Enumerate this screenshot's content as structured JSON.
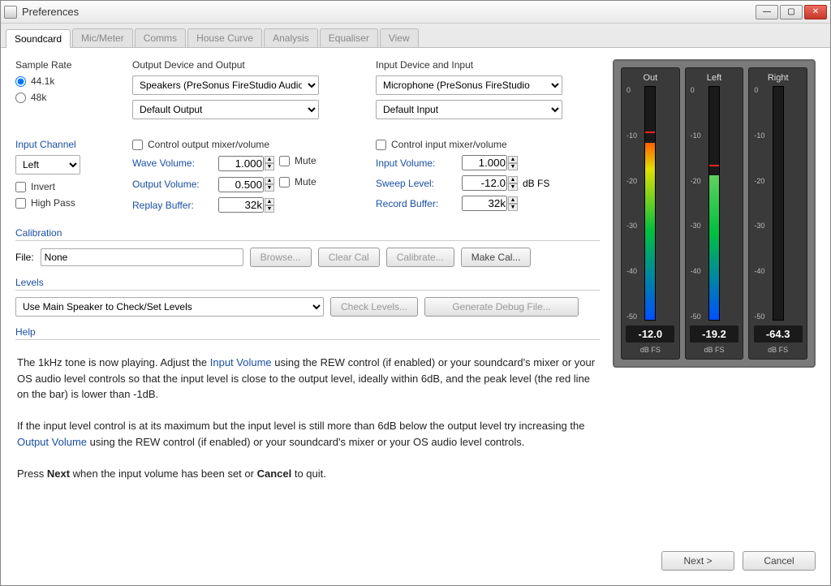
{
  "window": {
    "title": "Preferences"
  },
  "tabs": [
    "Soundcard",
    "Mic/Meter",
    "Comms",
    "House Curve",
    "Analysis",
    "Equaliser",
    "View"
  ],
  "sample_rate": {
    "label": "Sample Rate",
    "opt1": "44.1k",
    "opt2": "48k"
  },
  "output_device": {
    "label": "Output Device and Output",
    "device": "Speakers (PreSonus FireStudio Audio)",
    "output": "Default Output"
  },
  "input_device": {
    "label": "Input Device and Input",
    "device": "Microphone (PreSonus FireStudio",
    "input": "Default Input"
  },
  "input_channel": {
    "label": "Input Channel",
    "value": "Left",
    "invert": "Invert",
    "highpass": "High Pass"
  },
  "out_mixer": {
    "ctrl": "Control output mixer/volume",
    "wave_lbl": "Wave Volume:",
    "wave_val": "1.000",
    "mute": "Mute",
    "out_lbl": "Output Volume:",
    "out_val": "0.500",
    "buf_lbl": "Replay Buffer:",
    "buf_val": "32k"
  },
  "in_mixer": {
    "ctrl": "Control input mixer/volume",
    "in_lbl": "Input Volume:",
    "in_val": "1.000",
    "sweep_lbl": "Sweep Level:",
    "sweep_val": "-12.0",
    "sweep_unit": "dB FS",
    "buf_lbl": "Record Buffer:",
    "buf_val": "32k"
  },
  "calibration": {
    "head": "Calibration",
    "file_lbl": "File:",
    "file_val": "None",
    "browse": "Browse...",
    "clear": "Clear Cal",
    "calib": "Calibrate...",
    "make": "Make Cal..."
  },
  "levels": {
    "head": "Levels",
    "select": "Use Main Speaker to Check/Set Levels",
    "check": "Check Levels...",
    "debug": "Generate Debug File..."
  },
  "help": {
    "head": "Help",
    "p1a": "The 1kHz tone is now playing. Adjust the ",
    "p1link": "Input Volume",
    "p1b": " using the REW control (if enabled) or your soundcard's mixer or your OS audio level controls so that the input level is close to the output level, ideally within 6dB, and the peak level (the red line on the bar) is lower than -1dB.",
    "p2a": "If the input level control is at its maximum but the input level is still more than 6dB below the output level try increasing the ",
    "p2link": "Output Volume",
    "p2b": " using the REW control (if enabled) or your soundcard's mixer or your OS audio level controls.",
    "p3a": "Press ",
    "p3b1": "Next",
    "p3c": " when the input volume has been set or ",
    "p3b2": "Cancel",
    "p3d": " to quit."
  },
  "meters": {
    "out": {
      "title": "Out",
      "value": "-12.0"
    },
    "left": {
      "title": "Left",
      "value": "-19.2"
    },
    "right": {
      "title": "Right",
      "value": "-64.3"
    },
    "ticks": [
      "0",
      "-10",
      "-20",
      "-30",
      "-40",
      "-50"
    ],
    "unit": "dB FS"
  },
  "footer": {
    "next": "Next >",
    "cancel": "Cancel"
  }
}
